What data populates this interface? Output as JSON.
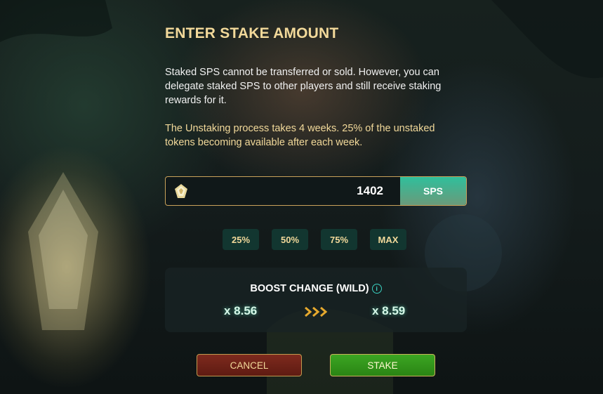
{
  "dialog": {
    "title": "ENTER STAKE AMOUNT",
    "description": "Staked SPS cannot be transferred or sold. However, you can delegate staked SPS to other players and still receive staking rewards for it.",
    "unstake_note": "The Unstaking process takes 4 weeks. 25% of the unstaked tokens becoming available after each week."
  },
  "amount": {
    "value": "1402",
    "currency": "SPS",
    "icon": "sps-token-icon"
  },
  "percent_buttons": [
    "25%",
    "50%",
    "75%",
    "MAX"
  ],
  "boost": {
    "title": "BOOST CHANGE (WILD)",
    "from": "x 8.56",
    "to": "x 8.59",
    "info_icon": "info-icon",
    "arrow_icon": "triple-chevron-right-icon"
  },
  "actions": {
    "cancel_label": "CANCEL",
    "stake_label": "STAKE"
  },
  "colors": {
    "gold": "#f2d99a",
    "teal": "#2fbf9c",
    "cancel": "#7e2a1e",
    "stake": "#3ca623"
  }
}
